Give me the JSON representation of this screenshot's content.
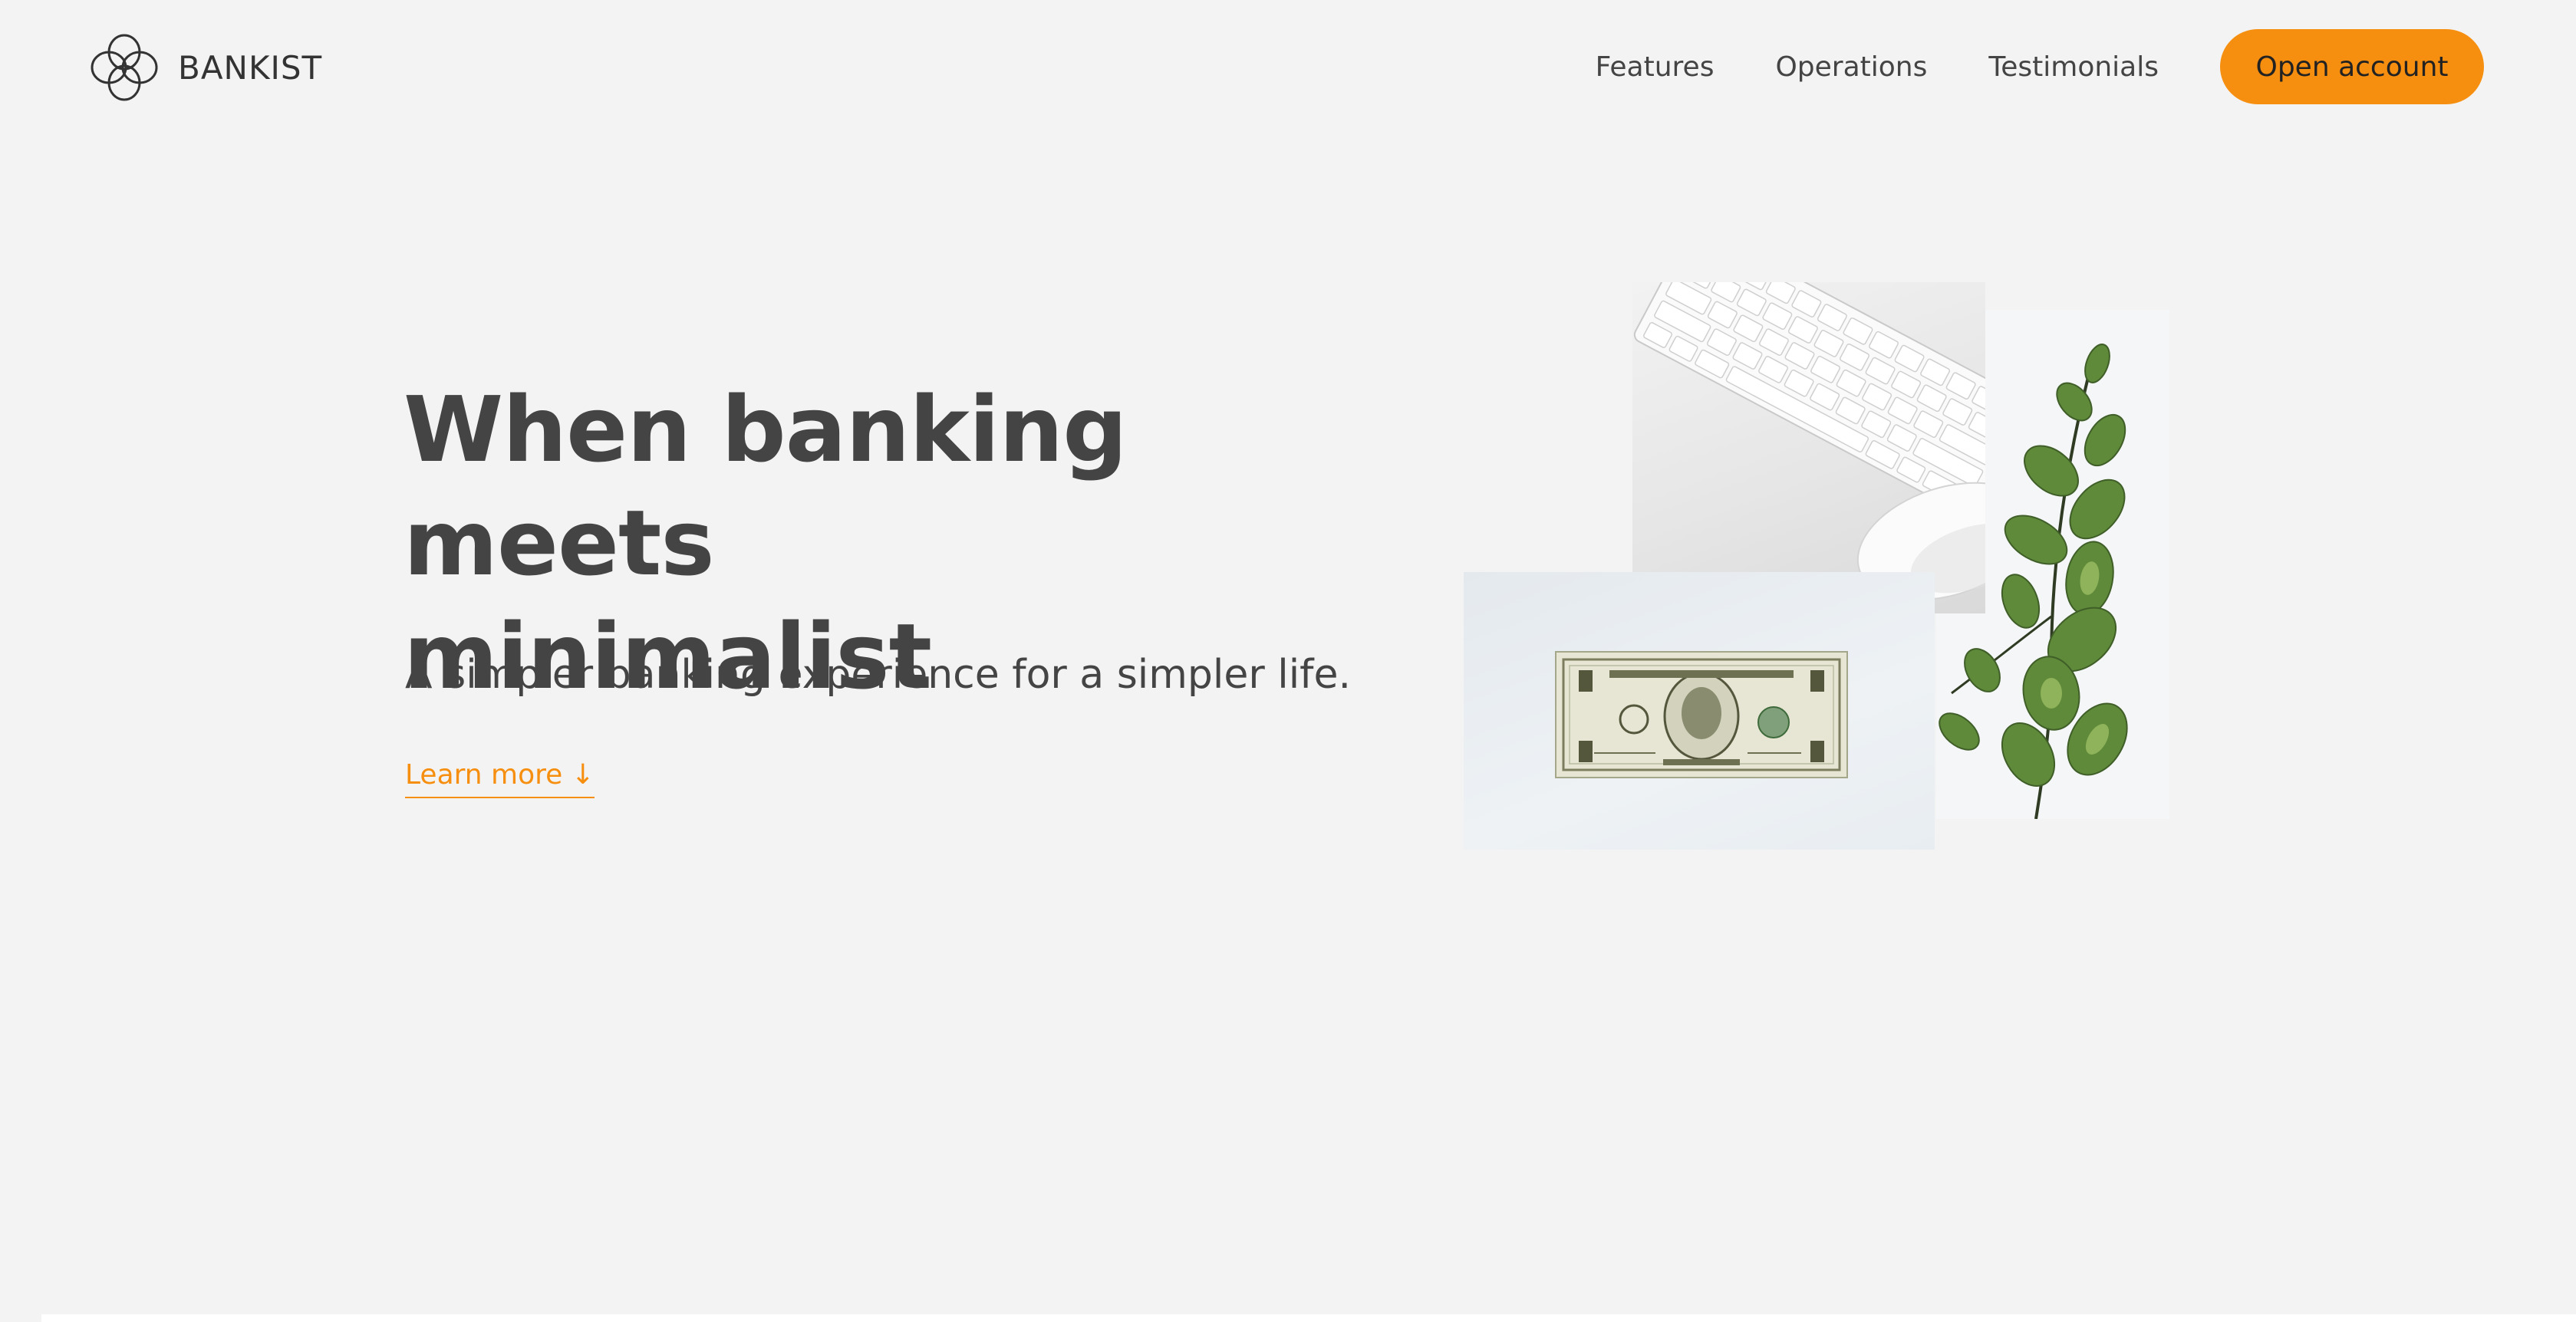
{
  "nav": {
    "brand": "BANKIST",
    "links": [
      "Features",
      "Operations",
      "Testimonials"
    ],
    "cta": "Open account"
  },
  "hero": {
    "title_line1": "When banking meets",
    "title_line2": "minimalist",
    "subtitle": "A simpler banking experience for a simpler life.",
    "link": "Learn more ↓"
  },
  "colors": {
    "background": "#f3f3f3",
    "accent": "#f68f0f",
    "text": "#444444"
  },
  "images": {
    "keyboard": "keyboard-mouse-photo",
    "plant": "eucalyptus-plant-photo",
    "money": "dollar-bill-photo"
  }
}
